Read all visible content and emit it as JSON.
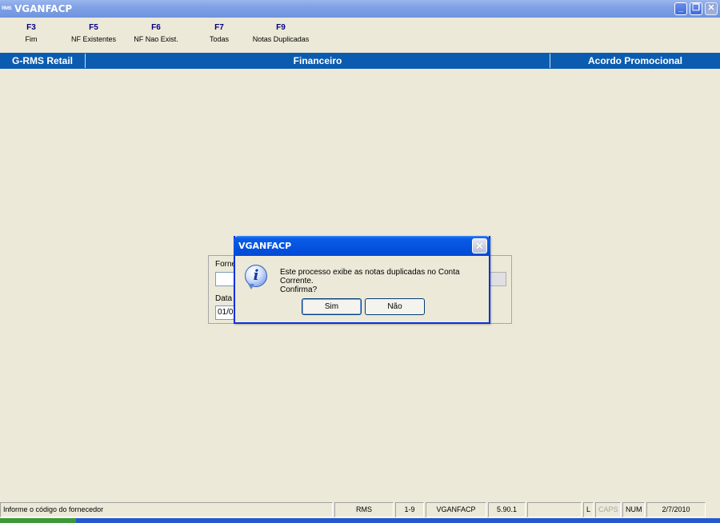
{
  "window": {
    "icon_text": "RMS",
    "title": "VGANFACP",
    "min_glyph": "_",
    "max_glyph": "❐",
    "close_glyph": "✕"
  },
  "fkeys": [
    {
      "key": "F3",
      "label": "Fim"
    },
    {
      "key": "F5",
      "label": "NF Existentes"
    },
    {
      "key": "F6",
      "label": "NF Nao Exist."
    },
    {
      "key": "F7",
      "label": "Todas"
    },
    {
      "key": "F9",
      "label": "Notas Duplicadas"
    }
  ],
  "header": {
    "left": "G-RMS Retail",
    "center": "Financeiro",
    "right": "Acordo Promocional"
  },
  "form": {
    "fornecedor_label": "Forne",
    "fornecedor_value": "",
    "data_label": "Data",
    "data_value": "01/0"
  },
  "dialog": {
    "title": "VGANFACP",
    "close_glyph": "✕",
    "icon_glyph": "i",
    "message_line1": "Este processo exibe as notas duplicadas no Conta Corrente.",
    "message_line2": "Confirma?",
    "yes_label": "Sim",
    "no_label": "Não"
  },
  "statusbar": {
    "message": "Informe o código do fornecedor",
    "system": "RMS",
    "range": "1-9",
    "program": "VGANFACP",
    "version": "5.90.1",
    "empty": "",
    "lock": "L",
    "caps": "CAPS",
    "num": "NUM",
    "date": "2/7/2010"
  },
  "colors": {
    "band": "#0b5cb0",
    "fkey_text": "#000080",
    "window_bg": "#ece9d8"
  }
}
